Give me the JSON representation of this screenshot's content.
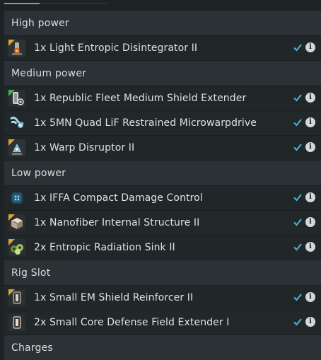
{
  "sections": [
    {
      "title": "High power",
      "items": [
        {
          "label": "1x  Light Entropic Disintegrator II",
          "icon": "entropic-disintegrator-icon"
        }
      ]
    },
    {
      "title": "Medium power",
      "items": [
        {
          "label": "1x  Republic Fleet Medium Shield Extender",
          "icon": "shield-extender-icon"
        },
        {
          "label": "1x  5MN Quad LiF Restrained Microwarpdrive",
          "icon": "microwarpdrive-icon"
        },
        {
          "label": "1x  Warp Disruptor II",
          "icon": "warp-disruptor-icon"
        }
      ]
    },
    {
      "title": "Low power",
      "items": [
        {
          "label": "1x  IFFA Compact Damage Control",
          "icon": "damage-control-icon"
        },
        {
          "label": "1x  Nanofiber Internal Structure II",
          "icon": "nanofiber-icon"
        },
        {
          "label": "2x  Entropic Radiation Sink II",
          "icon": "radiation-sink-icon"
        }
      ]
    },
    {
      "title": "Rig Slot",
      "items": [
        {
          "label": "1x  Small EM Shield Reinforcer II",
          "icon": "shield-reinforcer-rig-icon"
        },
        {
          "label": "2x  Small Core Defense Field Extender I",
          "icon": "field-extender-rig-icon"
        }
      ]
    },
    {
      "title": "Charges",
      "items": []
    }
  ],
  "colors": {
    "accent": "#6ea9b8",
    "check": "#4fb3d9",
    "tech2_badge": "#d9a53a",
    "faction_badge": "#4caf50"
  }
}
